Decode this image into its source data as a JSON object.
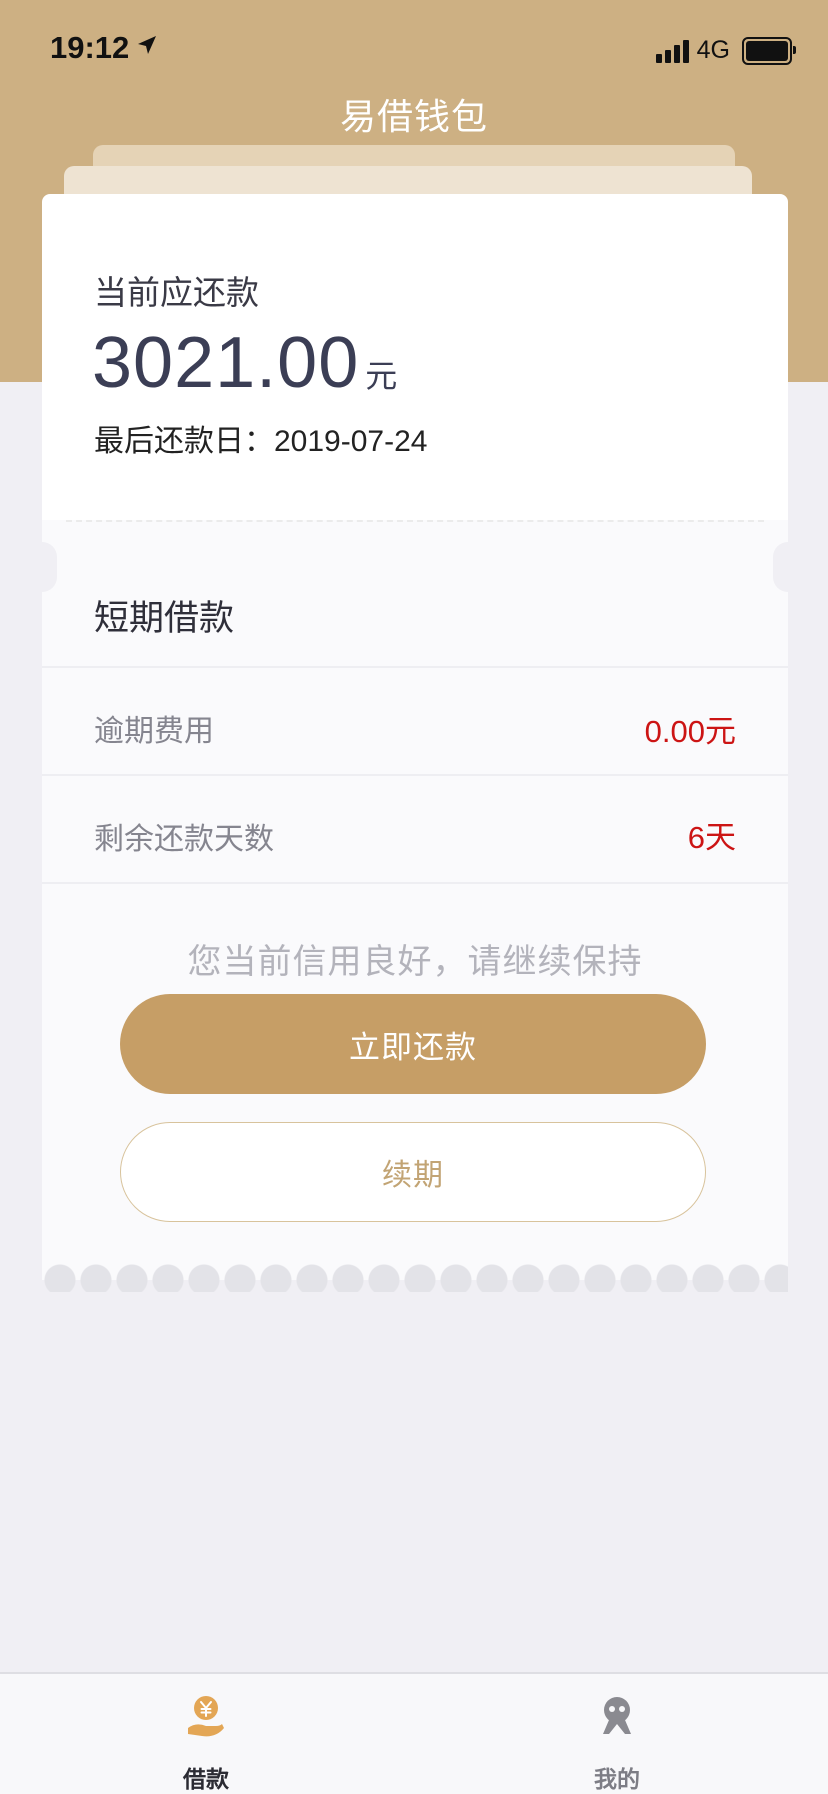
{
  "status_bar": {
    "time": "19:12",
    "network": "4G"
  },
  "header": {
    "title": "易借钱包"
  },
  "repayment": {
    "label": "当前应还款",
    "amount": "3021.00",
    "unit": "元",
    "deadline_label": "最后还款日：",
    "deadline": "2019-07-24"
  },
  "loan": {
    "type": "短期借款",
    "rows": [
      {
        "label": "逾期费用",
        "value": "0.00元"
      },
      {
        "label": "剩余还款天数",
        "value": "6天"
      }
    ]
  },
  "tip": "您当前信用良好，请继续保持",
  "buttons": {
    "repay_now": "立即还款",
    "renew": "续期"
  },
  "tab_bar": {
    "items": [
      {
        "label": "借款",
        "icon": "hand-yuan-icon",
        "active": true
      },
      {
        "label": "我的",
        "icon": "person-icon",
        "active": false
      }
    ]
  },
  "colors": {
    "header": "#cdb083",
    "accent": "#c69e66",
    "alert": "#cc1414",
    "page_bg": "#f0eff4"
  }
}
